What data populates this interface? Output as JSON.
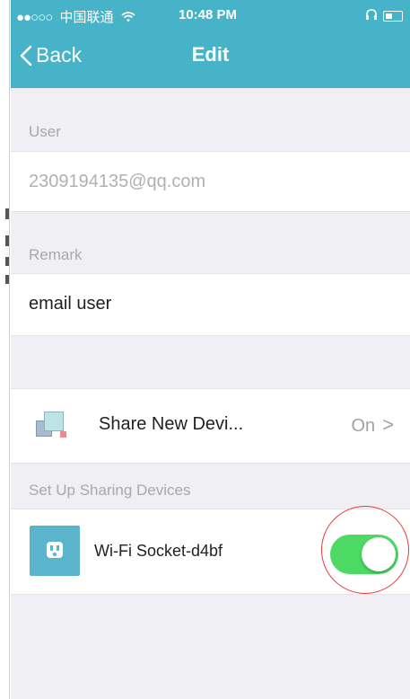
{
  "status_bar": {
    "signal_dots": "●●○○○",
    "carrier": "中国联通",
    "wifi_icon": "wifi-icon",
    "time": "10:48 PM",
    "headphone_icon": "headphone-icon",
    "battery_icon": "battery-icon"
  },
  "nav": {
    "back_label": "Back",
    "title": "Edit",
    "bar_color": "#46b3c8"
  },
  "user_section": {
    "header": "User",
    "value": "2309194135@qq.com"
  },
  "remark_section": {
    "header": "Remark",
    "value": "email user"
  },
  "share_row": {
    "icon": "share-devices-icon",
    "label": "Share New Devi...",
    "status": "On",
    "chevron": ">"
  },
  "sharing_section": {
    "header": "Set Up Sharing Devices",
    "devices": [
      {
        "icon": "wifi-socket-icon",
        "name": "Wi-Fi Socket-d4bf",
        "enabled": true,
        "toggle_color": "#4cd964"
      }
    ]
  },
  "annotation": {
    "circle_color": "#e83a3a"
  }
}
